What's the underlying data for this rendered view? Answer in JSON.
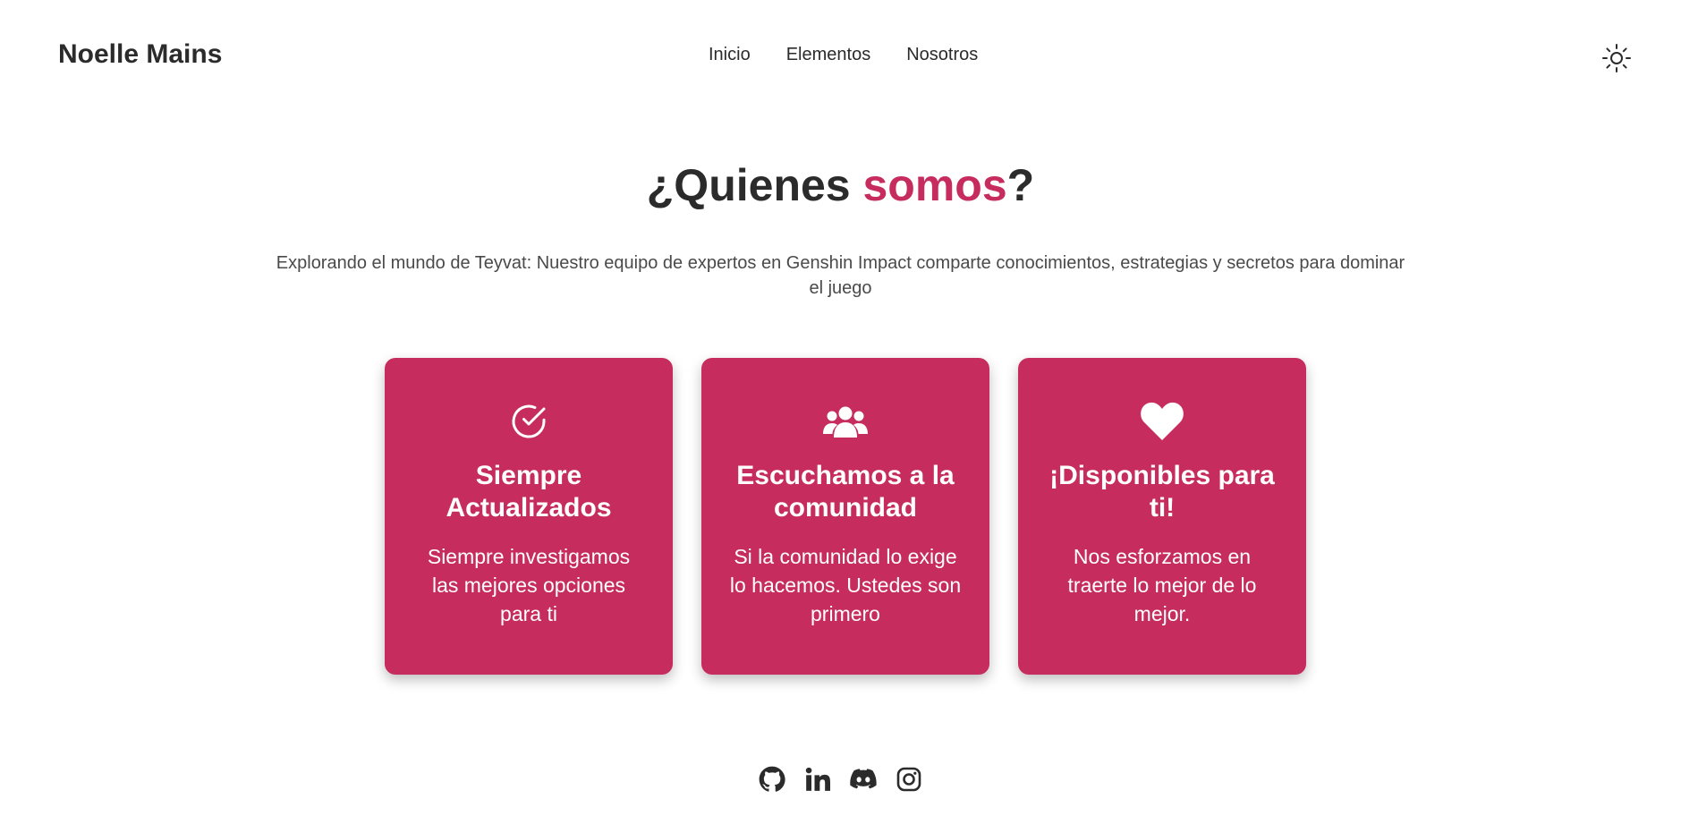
{
  "header": {
    "brand": "Noelle Mains",
    "nav": [
      "Inicio",
      "Elementos",
      "Nosotros"
    ],
    "theme_icon": "sun-icon"
  },
  "hero": {
    "title_prefix": "¿Quienes ",
    "title_accent": "somos",
    "title_suffix": "?",
    "subtitle": "Explorando el mundo de Teyvat: Nuestro equipo de expertos en Genshin Impact comparte conocimientos, estrategias y secretos para dominar el juego"
  },
  "cards": [
    {
      "icon": "check-circle-icon",
      "title": "Siempre Actualizados",
      "text": "Siempre investigamos las mejores opciones para ti"
    },
    {
      "icon": "users-icon",
      "title": "Escuchamos a la comunidad",
      "text": "Si la comunidad lo exige lo hacemos. Ustedes son primero"
    },
    {
      "icon": "heart-icon",
      "title": "¡Disponibles para ti!",
      "text": "Nos esforzamos en traerte lo mejor de lo mejor."
    }
  ],
  "footer": {
    "social_icons": [
      "github-icon",
      "linkedin-icon",
      "discord-icon",
      "instagram-icon"
    ]
  },
  "colors": {
    "accent": "#c62c5e",
    "text": "#2b2b2b"
  }
}
